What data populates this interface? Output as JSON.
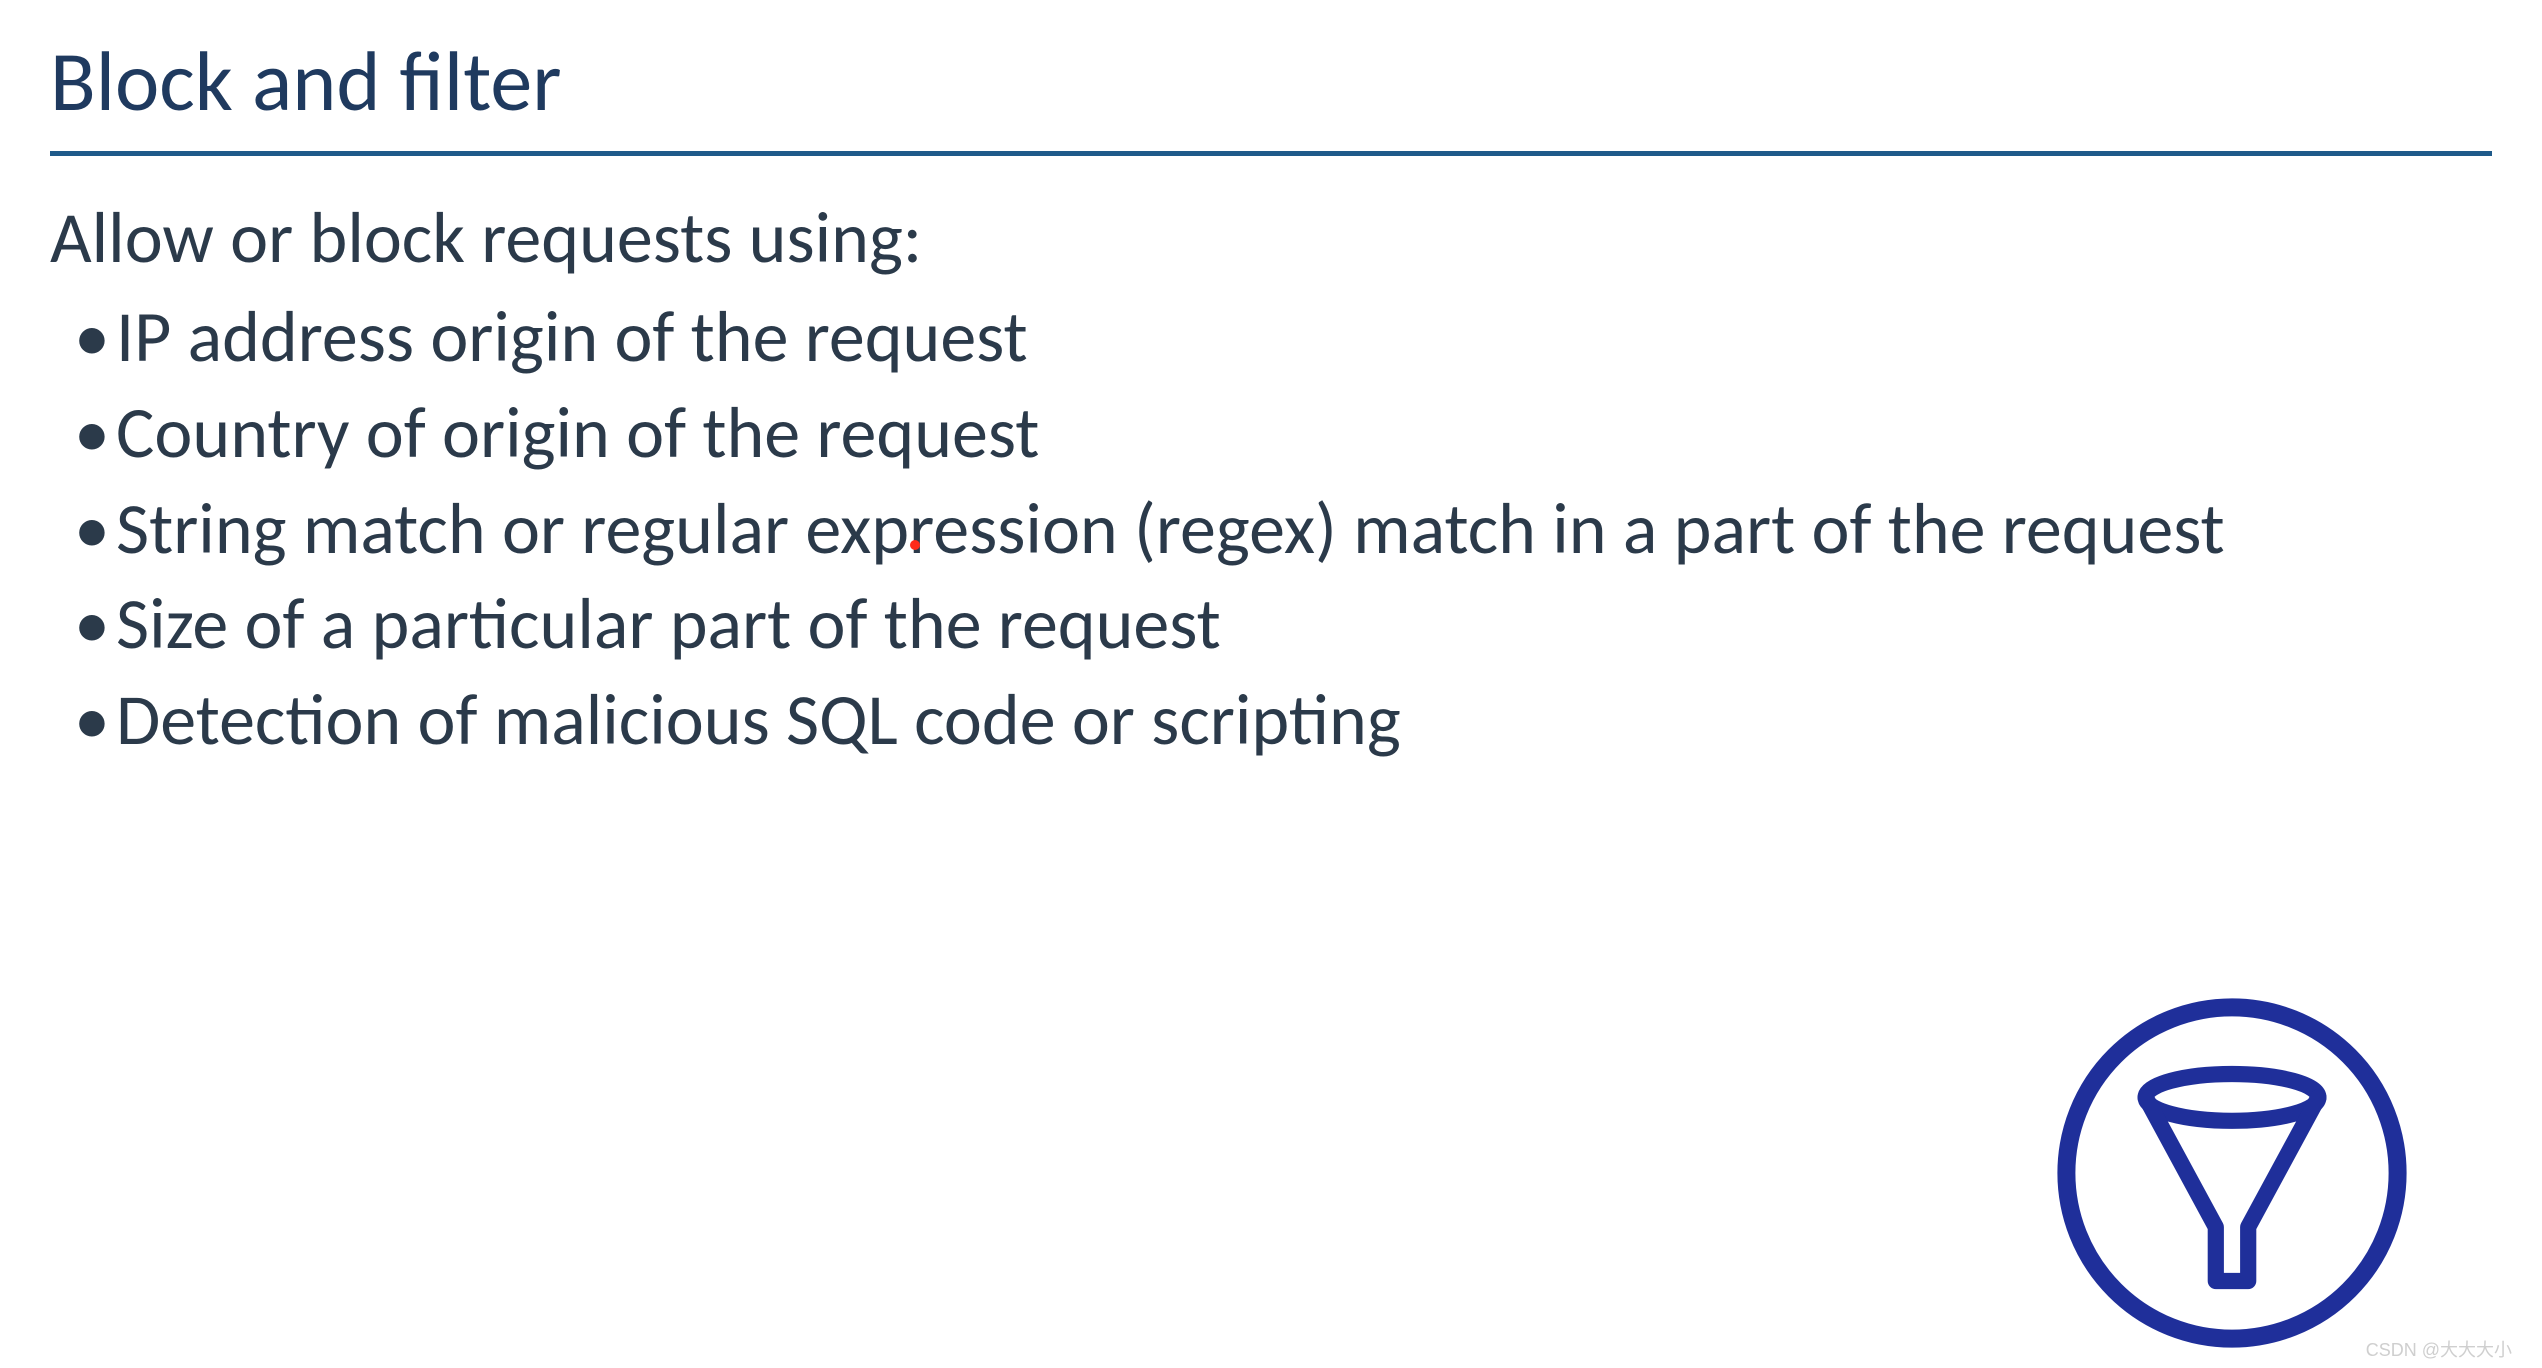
{
  "slide": {
    "title": "Block and filter",
    "intro": "Allow or block requests using:",
    "bullets": [
      "IP address origin of the request",
      "Country of origin of the request",
      "String match or regular expression (regex) match in a part of the request",
      "Size of a particular part of the request",
      "Detection of malicious SQL code or scripting"
    ]
  },
  "icon": {
    "name": "funnel-filter-icon",
    "color": "#1f2f9a"
  },
  "watermark": "CSDN @大大大小"
}
